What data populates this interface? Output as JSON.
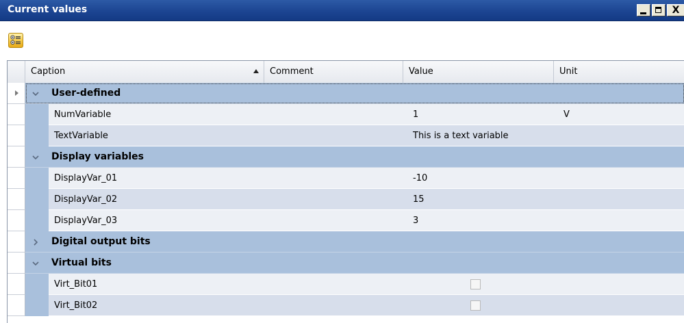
{
  "window": {
    "title": "Current values",
    "buttons": {
      "minimize": "_",
      "maximize": "□",
      "close": "X"
    }
  },
  "toolbar": {
    "icon": "properties-list-icon"
  },
  "grid": {
    "columns": [
      {
        "label": "Caption",
        "sort": "ascending"
      },
      {
        "label": "Comment"
      },
      {
        "label": "Value"
      },
      {
        "label": "Unit"
      }
    ],
    "groups": [
      {
        "label": "User-defined",
        "expanded": true,
        "rows": [
          {
            "caption": "NumVariable",
            "comment": "",
            "value": "1",
            "unit": "V"
          },
          {
            "caption": "TextVariable",
            "comment": "",
            "value": "This is a text variable",
            "unit": ""
          }
        ]
      },
      {
        "label": "Display variables",
        "expanded": true,
        "rows": [
          {
            "caption": "DisplayVar_01",
            "comment": "",
            "value": "-10",
            "unit": ""
          },
          {
            "caption": "DisplayVar_02",
            "comment": "",
            "value": "15",
            "unit": ""
          },
          {
            "caption": "DisplayVar_03",
            "comment": "",
            "value": "3",
            "unit": ""
          }
        ]
      },
      {
        "label": "Digital output bits",
        "expanded": false,
        "rows": []
      },
      {
        "label": "Virtual bits",
        "expanded": true,
        "rows": [
          {
            "caption": "Virt_Bit01",
            "comment": "",
            "checked": false,
            "unit": ""
          },
          {
            "caption": "Virt_Bit02",
            "comment": "",
            "checked": false,
            "unit": ""
          }
        ]
      }
    ]
  },
  "colors": {
    "titlebar": "#1c4592",
    "group_row": "#a9c0dc",
    "row_odd": "#edf0f5",
    "row_even": "#d7deeb"
  }
}
